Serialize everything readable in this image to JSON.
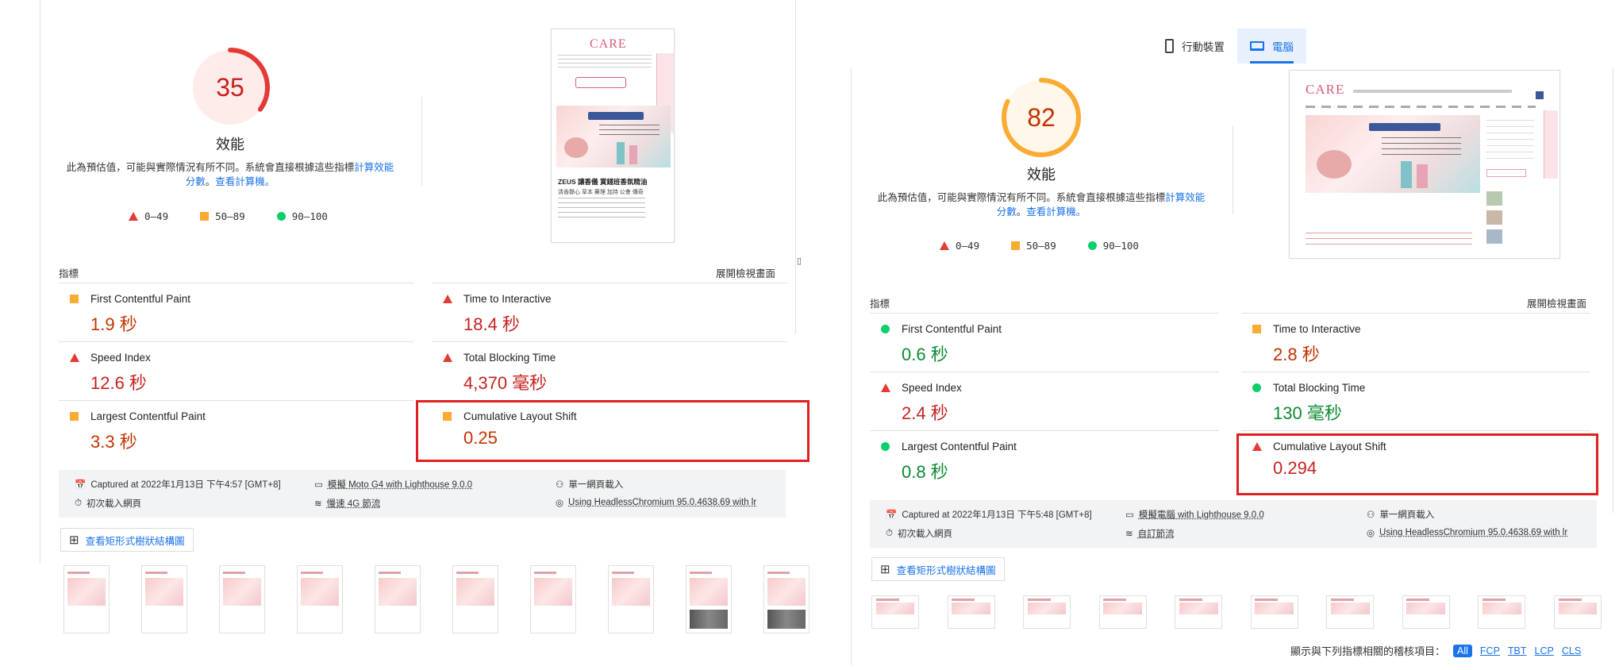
{
  "left": {
    "score": "35",
    "score_value": 35,
    "gauge_color": "#e53935",
    "gauge_bg": "#fdecea",
    "score_text_color": "#c5221f",
    "title": "效能",
    "desc_main": "此為預估值，可能與實際情況有所不同。系統會直接根據這些指標",
    "desc_link1": "計算效能分數",
    "desc_sep": "。",
    "desc_link2": "查看計算機。",
    "legend": {
      "fail": "0–49",
      "avg": "50–89",
      "pass": "90–100"
    },
    "metrics_label": "指標",
    "expand_label": "展開檢視畫面",
    "metrics": [
      {
        "name": "First Contentful Paint",
        "value": "1.9 秒",
        "status": "average"
      },
      {
        "name": "Time to Interactive",
        "value": "18.4 秒",
        "status": "fail"
      },
      {
        "name": "Speed Index",
        "value": "12.6 秒",
        "status": "fail"
      },
      {
        "name": "Total Blocking Time",
        "value": "4,370 毫秒",
        "status": "fail"
      },
      {
        "name": "Largest Contentful Paint",
        "value": "3.3 秒",
        "status": "average"
      },
      {
        "name": "Cumulative Layout Shift",
        "value": "0.25",
        "status": "average"
      }
    ],
    "info": {
      "captured": "Captured at 2022年1月13日 下午4:57 [GMT+8]",
      "device": "模擬 Moto G4 with Lighthouse 9.0.0",
      "session": "單一網頁載入",
      "load": "初次載入網頁",
      "network": "慢速 4G 節流",
      "browser": "Using HeadlessChromium 95.0.4638.69 with lr"
    },
    "tree_btn": "查看矩形式樹狀結構圖",
    "preview": {
      "logo": "CARE",
      "ad_title": "ZEUS 讓香儀 賞錢班香氛精油",
      "ad_sub": "清香靜心 草本 藥理 加持 公會 傳奇"
    }
  },
  "right": {
    "score": "82",
    "score_value": 82,
    "gauge_color": "#fbaa32",
    "gauge_bg": "#fff7e9",
    "score_text_color": "#c33300",
    "title": "效能",
    "desc_main": "此為預估值，可能與實際情況有所不同。系統會直接根據這些指標",
    "desc_link1": "計算效能分數",
    "desc_sep": "。",
    "desc_link2": "查看計算機。",
    "legend": {
      "fail": "0–49",
      "avg": "50–89",
      "pass": "90–100"
    },
    "metrics_label": "指標",
    "expand_label": "展開檢視畫面",
    "metrics": [
      {
        "name": "First Contentful Paint",
        "value": "0.6 秒",
        "status": "pass"
      },
      {
        "name": "Time to Interactive",
        "value": "2.8 秒",
        "status": "average"
      },
      {
        "name": "Speed Index",
        "value": "2.4 秒",
        "status": "fail"
      },
      {
        "name": "Total Blocking Time",
        "value": "130 毫秒",
        "status": "pass"
      },
      {
        "name": "Largest Contentful Paint",
        "value": "0.8 秒",
        "status": "pass"
      },
      {
        "name": "Cumulative Layout Shift",
        "value": "0.294",
        "status": "fail"
      }
    ],
    "info": {
      "captured": "Captured at 2022年1月13日 下午5:48 [GMT+8]",
      "device": "模擬電腦 with Lighthouse 9.0.0",
      "session": "單一網頁載入",
      "load": "初次載入網頁",
      "network": "自訂節流",
      "browser": "Using HeadlessChromium 95.0.4638.69 with lr"
    },
    "tree_btn": "查看矩形式樹狀結構圖",
    "tabs": {
      "mobile": "行動裝置",
      "desktop": "電腦"
    },
    "filter": {
      "label": "顯示與下列指標相關的稽核項目：",
      "chips": [
        "All",
        "FCP",
        "TBT",
        "LCP",
        "CLS"
      ]
    },
    "preview": {
      "logo": "CARE"
    }
  },
  "colors": {
    "link": "#1a73e8",
    "highlight": "#e02020",
    "fail": "#e53935",
    "average": "#fbaa32",
    "pass": "#0cce6b"
  }
}
